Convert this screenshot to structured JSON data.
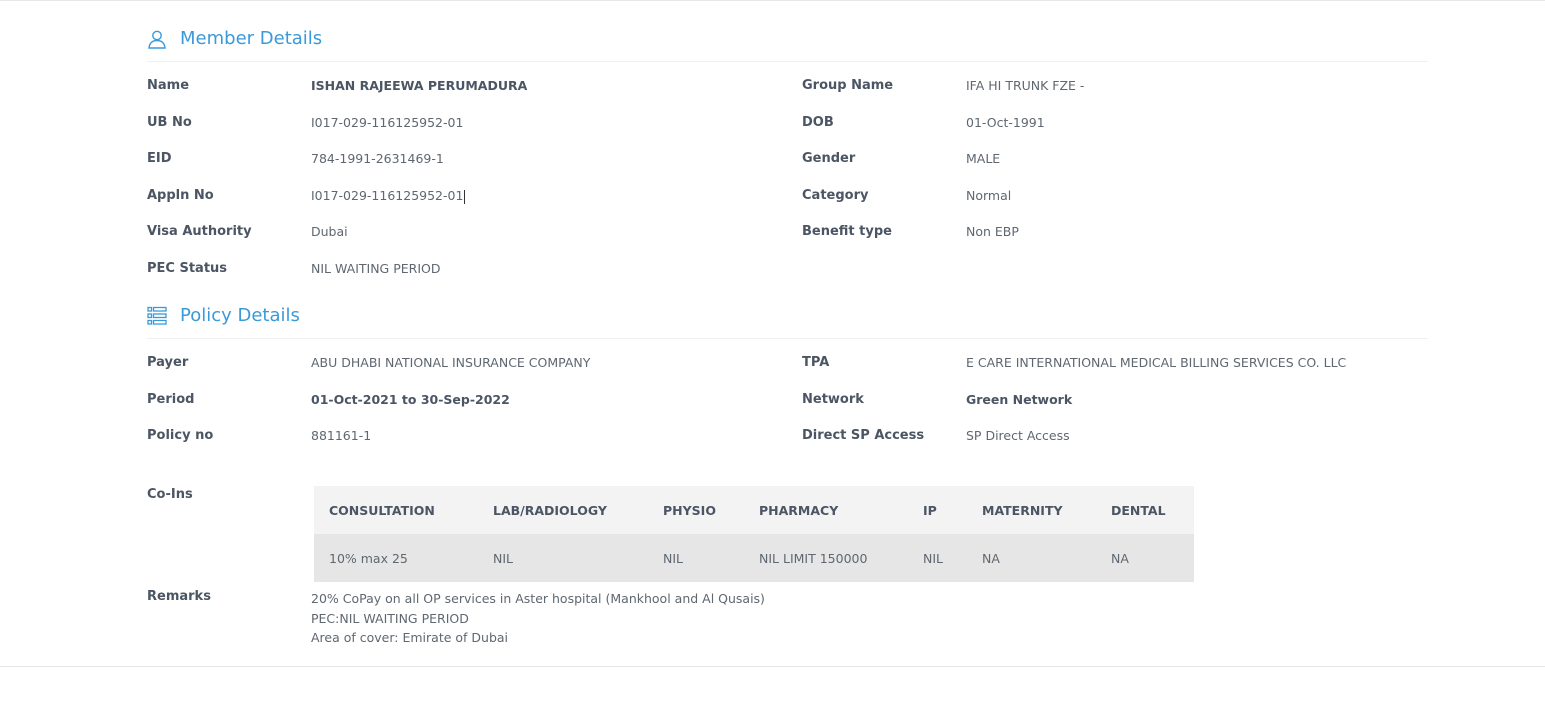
{
  "member_section": {
    "title": "Member Details",
    "icon": "user-icon",
    "left_fields": [
      {
        "label": "Name",
        "value": "ISHAN RAJEEWA PERUMADURA",
        "bold": true
      },
      {
        "label": "UB No",
        "value": "I017-029-116125952-01"
      },
      {
        "label": "EID",
        "value": "784-1991-2631469-1"
      },
      {
        "label": "Appln No",
        "value": "I017-029-116125952-01"
      },
      {
        "label": "Visa Authority",
        "value": "Dubai"
      },
      {
        "label": "PEC Status",
        "value": "NIL WAITING PERIOD"
      }
    ],
    "right_fields": [
      {
        "label": "Group Name",
        "value": "IFA HI TRUNK FZE -"
      },
      {
        "label": "DOB",
        "value": "01-Oct-1991"
      },
      {
        "label": "Gender",
        "value": "MALE"
      },
      {
        "label": "Category",
        "value": "Normal"
      },
      {
        "label": "Benefit type",
        "value": "Non EBP"
      }
    ]
  },
  "policy_section": {
    "title": "Policy Details",
    "icon": "list-icon",
    "left_fields": [
      {
        "label": "Payer",
        "value": "ABU DHABI NATIONAL INSURANCE COMPANY"
      },
      {
        "label": "Period",
        "value": "01-Oct-2021 to 30-Sep-2022",
        "bold": true
      },
      {
        "label": "Policy no",
        "value": "881161-1"
      }
    ],
    "right_fields": [
      {
        "label": "TPA",
        "value": "E CARE INTERNATIONAL MEDICAL BILLING SERVICES CO. LLC"
      },
      {
        "label": "Network",
        "value": "Green Network",
        "bold": true
      },
      {
        "label": "Direct SP Access",
        "value": "SP Direct Access"
      }
    ]
  },
  "coins": {
    "label": "Co-Ins",
    "headers": [
      "CONSULTATION",
      "LAB/RADIOLOGY",
      "PHYSIO",
      "PHARMACY",
      "IP",
      "MATERNITY",
      "DENTAL"
    ],
    "row": [
      "10% max 25",
      "NIL",
      "NIL",
      "NIL LIMIT 150000",
      "NIL",
      "NA",
      "NA"
    ]
  },
  "remarks": {
    "label": "Remarks",
    "lines": [
      "20% CoPay on all OP services in Aster hospital (Mankhool and Al Qusais)",
      "PEC:NIL WAITING PERIOD",
      "Area of cover: Emirate of Dubai"
    ]
  },
  "colors": {
    "accent": "#3a9ad9",
    "label": "#4b5563",
    "value": "#5f6770",
    "table_header_bg": "#f3f3f3",
    "table_row_bg": "#e6e6e6"
  }
}
